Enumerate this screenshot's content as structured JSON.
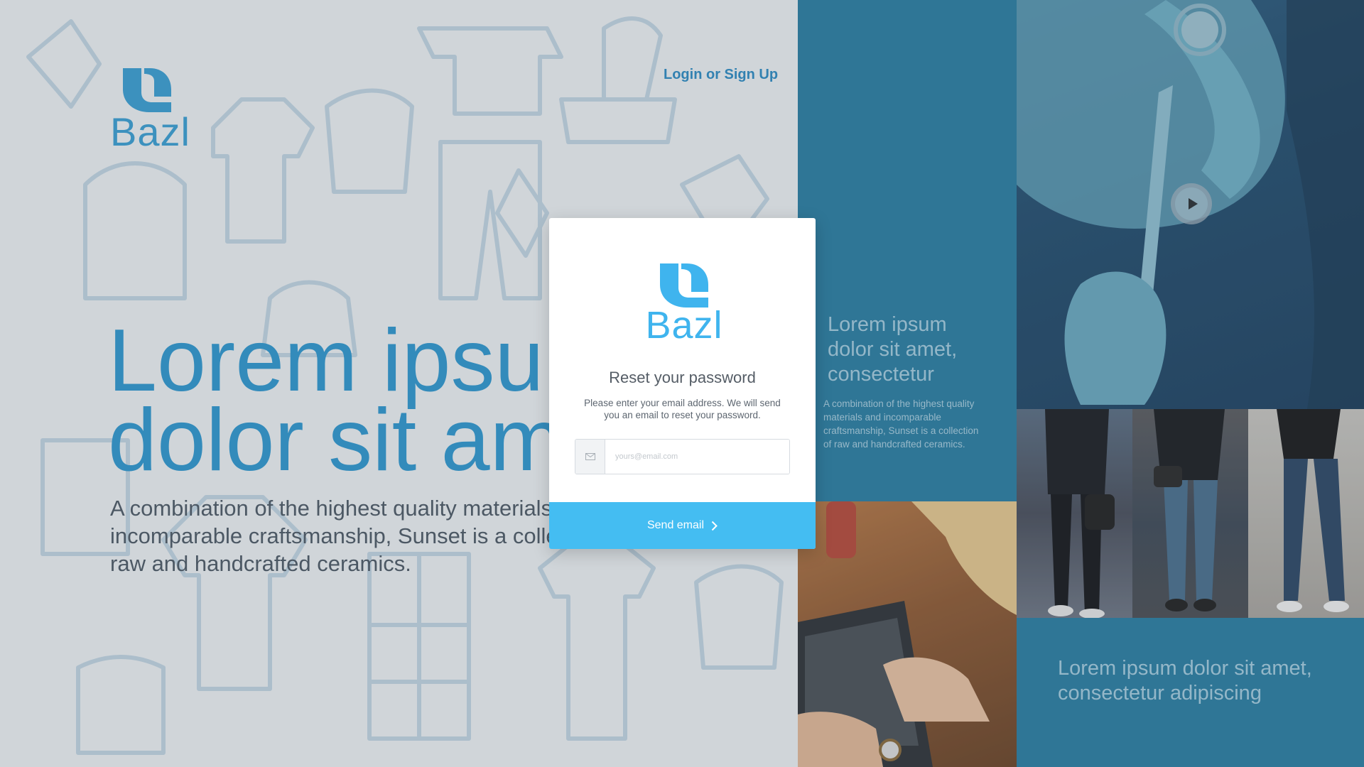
{
  "brand": {
    "name": "Bazl",
    "color": "#3a9fd4",
    "modal_color": "#3fb4ee"
  },
  "header": {
    "login_link": "Login or Sign Up"
  },
  "hero": {
    "title_line1": "Lorem ipsum",
    "title_line2": "dolor sit amet",
    "desc_line1": "A combination of the highest quality materials and",
    "desc_line2": "incomparable craftsmanship, Sunset is a collection of",
    "desc_line3": "raw and handcrafted ceramics."
  },
  "panel_top": {
    "title": "Lorem ipsum dolor sit amet, consectetur",
    "text": "A combination of the highest quality materials and incomparable craftsmanship, Sunset is a collection of raw and handcrafted ceramics."
  },
  "panel_bottom": {
    "title": "Lorem ipsum dolor sit amet, consectetur adipiscing"
  },
  "modal": {
    "title": "Reset your password",
    "description": "Please enter your email address. We will send you an email to reset your password.",
    "email_placeholder": "yours@email.com",
    "email_value": "",
    "send_label": "Send email",
    "email_icon": "envelope-icon",
    "send_icon": "chevron-right-icon"
  },
  "media": {
    "play_icon": "play-icon"
  },
  "colors": {
    "accent": "#44bdf2",
    "panel_blue": "#2a7ea3",
    "title_blue": "#2f98d0"
  }
}
